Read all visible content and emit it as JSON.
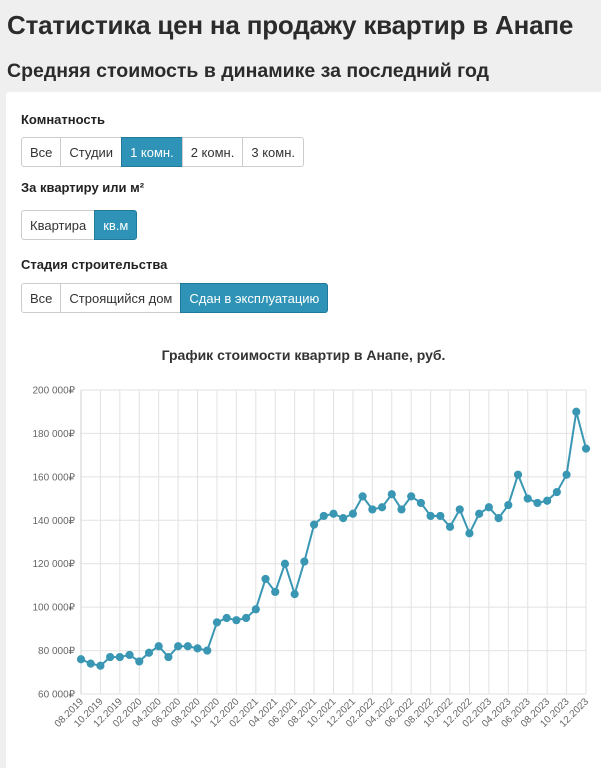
{
  "page": {
    "title": "Статистика цен на продажу квартир в Анапе",
    "subtitle": "Средняя стоимость в динамике за последний год"
  },
  "filters": {
    "rooms": {
      "label": "Комнатность",
      "options": [
        "Все",
        "Студии",
        "1 комн.",
        "2 комн.",
        "3 комн."
      ],
      "selected": "1 комн."
    },
    "unit": {
      "label": "За квартиру или м²",
      "options": [
        "Квартира",
        "кв.м"
      ],
      "selected": "кв.м"
    },
    "stage": {
      "label": "Стадия строительства",
      "options": [
        "Все",
        "Строящийся дом",
        "Сдан в эксплуатацию"
      ],
      "selected": "Сдан в эксплуатацию"
    }
  },
  "colors": {
    "accent": "#2e93b6",
    "line": "#3a97b4",
    "grid": "#e2e2e2"
  },
  "chart_data": {
    "type": "line",
    "title": "График стоимости квартир в Анапе, руб.",
    "y_tick_labels": [
      "60 000₽",
      "80 000₽",
      "100 000₽",
      "120 000₽",
      "140 000₽",
      "160 000₽",
      "180 000₽",
      "200 000₽"
    ],
    "ylim": [
      60000,
      200000
    ],
    "grid": true,
    "x_tick_labels": [
      "08.2019",
      "10.2019",
      "12.2019",
      "02.2020",
      "04.2020",
      "06.2020",
      "08.2020",
      "10.2020",
      "12.2020",
      "02.2021",
      "04.2021",
      "06.2021",
      "08.2021",
      "10.2021",
      "12.2021",
      "02.2022",
      "04.2022",
      "06.2022",
      "08.2022",
      "10.2022",
      "12.2022",
      "02.2023",
      "04.2023",
      "06.2023",
      "08.2023",
      "10.2023",
      "12.2023"
    ],
    "x": [
      "08.2019",
      "09.2019",
      "10.2019",
      "11.2019",
      "12.2019",
      "01.2020",
      "02.2020",
      "03.2020",
      "04.2020",
      "05.2020",
      "06.2020",
      "07.2020",
      "08.2020",
      "09.2020",
      "10.2020",
      "11.2020",
      "12.2020",
      "01.2021",
      "02.2021",
      "03.2021",
      "04.2021",
      "05.2021",
      "06.2021",
      "07.2021",
      "08.2021",
      "09.2021",
      "10.2021",
      "11.2021",
      "12.2021",
      "01.2022",
      "02.2022",
      "03.2022",
      "04.2022",
      "05.2022",
      "06.2022",
      "07.2022",
      "08.2022",
      "09.2022",
      "10.2022",
      "11.2022",
      "12.2022",
      "01.2023",
      "02.2023",
      "03.2023",
      "04.2023",
      "05.2023",
      "06.2023",
      "07.2023",
      "08.2023",
      "09.2023",
      "10.2023",
      "11.2023",
      "12.2023"
    ],
    "series": [
      {
        "values": [
          76000,
          74000,
          73000,
          77000,
          77000,
          78000,
          75000,
          79000,
          82000,
          77000,
          82000,
          82000,
          81000,
          80000,
          93000,
          95000,
          94000,
          95000,
          99000,
          113000,
          107000,
          120000,
          106000,
          121000,
          138000,
          142000,
          143000,
          141000,
          143000,
          151000,
          145000,
          146000,
          152000,
          145000,
          151000,
          148000,
          142000,
          142000,
          137000,
          145000,
          134000,
          143000,
          146000,
          141000,
          147000,
          161000,
          150000,
          148000,
          149000,
          153000,
          161000,
          190000,
          173000
        ]
      }
    ]
  }
}
